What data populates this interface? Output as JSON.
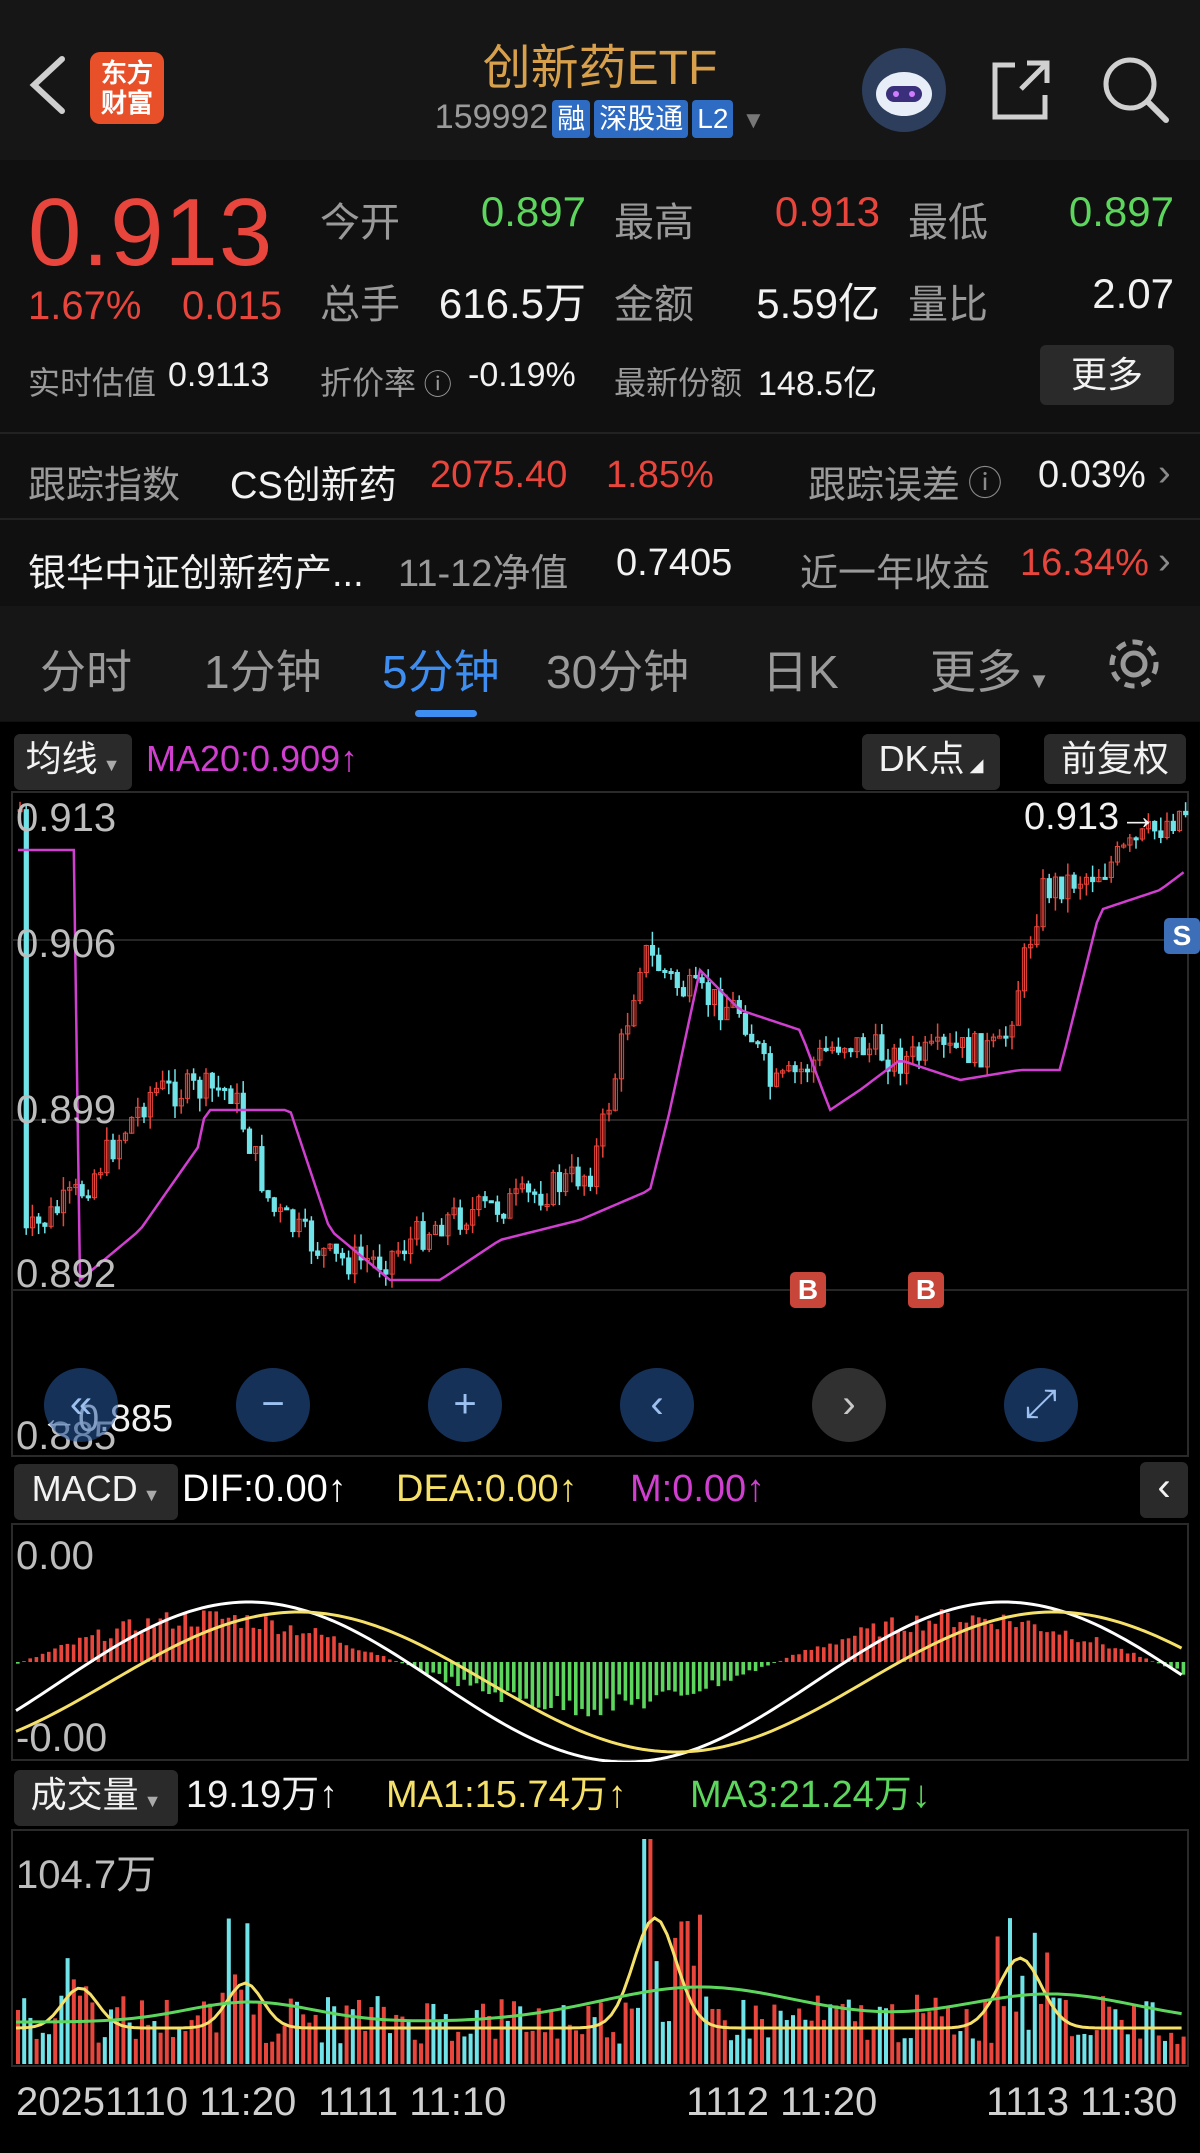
{
  "header": {
    "title": "创新药ETF",
    "code": "159992",
    "tags": [
      "融",
      "深股通",
      "L2"
    ],
    "logo_text": "东方财富"
  },
  "quote": {
    "price": "0.913",
    "change_pct": "1.67%",
    "change_amt": "0.015",
    "open_label": "今开",
    "open": "0.897",
    "high_label": "最高",
    "high": "0.913",
    "low_label": "最低",
    "low": "0.897",
    "volume_label": "总手",
    "volume": "616.5万",
    "amount_label": "金额",
    "amount": "5.59亿",
    "ratio_label": "量比",
    "ratio": "2.07",
    "iopv_label": "实时估值",
    "iopv": "0.9113",
    "discount_label": "折价率",
    "discount": "-0.19%",
    "shares_label": "最新份额",
    "shares": "148.5亿",
    "more_label": "更多"
  },
  "tracking": {
    "label": "跟踪指数",
    "index_name": "CS创新药",
    "index_value": "2075.40",
    "index_pct": "1.85%",
    "error_label": "跟踪误差",
    "error_value": "0.03%"
  },
  "fund": {
    "name": "银华中证创新药产...",
    "nav_label": "11-12净值",
    "nav": "0.7405",
    "return_label": "近一年收益",
    "return": "16.34%"
  },
  "tabs": [
    "分时",
    "1分钟",
    "5分钟",
    "30分钟",
    "日K",
    "更多"
  ],
  "main_chart": {
    "ma_selector": "均线",
    "ma20_text": "MA20:0.909↑",
    "dk_label": "DK点",
    "adjust_label": "前复权",
    "y_labels": [
      "0.913",
      "0.906",
      "0.899",
      "0.892",
      "0.885"
    ],
    "max_marker": "0.913→",
    "min_marker": "←0.885",
    "buy_marks": [
      "B",
      "B"
    ],
    "sell_mark": "S"
  },
  "macd": {
    "selector": "MACD",
    "dif": "DIF:0.00↑",
    "dea": "DEA:0.00↑",
    "m": "M:0.00↑",
    "y_top": "0.00",
    "y_bottom": "-0.00"
  },
  "volume": {
    "selector": "成交量",
    "vol": "19.19万↑",
    "ma1": "MA1:15.74万↑",
    "ma3": "MA3:21.24万↓",
    "y_top": "104.7万"
  },
  "x_axis": [
    "20251110 11:20",
    "1111 11:10",
    "1112 11:20",
    "1113 11:30"
  ],
  "colors": {
    "up": "#e8453c",
    "down": "#6fe3e8",
    "ma20": "#d03fd0",
    "dif": "#ffffff",
    "dea": "#f5e06a",
    "ma3": "#5dd65d",
    "accent": "#3d8ef0",
    "title": "#d8a04b"
  }
}
